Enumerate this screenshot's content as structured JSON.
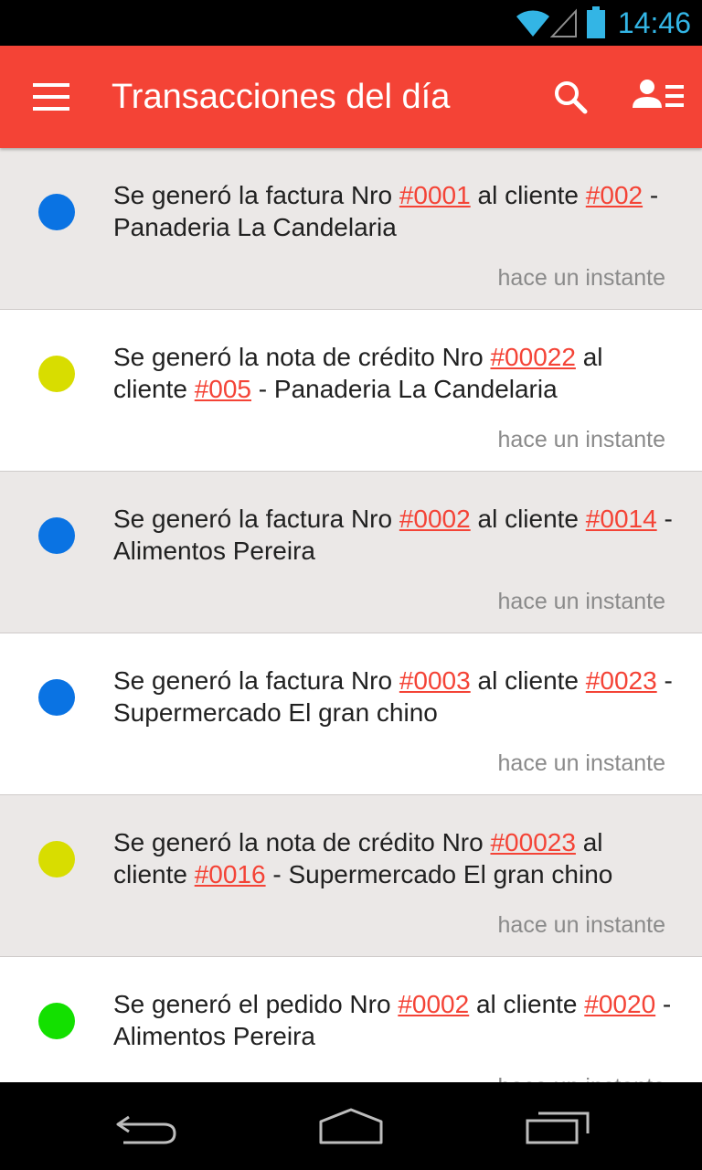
{
  "status_bar": {
    "time": "14:46",
    "accent_color": "#33b5e5",
    "icons": [
      "wifi-icon",
      "signal-icon",
      "battery-icon"
    ]
  },
  "app_bar": {
    "title": "Transacciones del día",
    "color": "#f44336",
    "icons": [
      "menu-icon",
      "search-icon",
      "contacts-icon"
    ]
  },
  "transactions": [
    {
      "color": "#0a73e3",
      "shaded": true,
      "prefix": "Se generó la factura Nro ",
      "doc": "#0001",
      "middle": " al cliente ",
      "client": "#002",
      "suffix": " - Panaderia La Candelaria",
      "time": "hace un instante"
    },
    {
      "color": "#d8dd00",
      "shaded": false,
      "prefix": "Se generó la nota de crédito Nro ",
      "doc": "#00022",
      "middle": " al cliente ",
      "client": "#005",
      "suffix": " - Panaderia La Candelaria",
      "time": "hace un instante"
    },
    {
      "color": "#0a73e3",
      "shaded": true,
      "prefix": "Se generó la factura Nro ",
      "doc": "#0002",
      "middle": " al cliente ",
      "client": "#0014",
      "suffix": " - Alimentos Pereira",
      "time": "hace un instante"
    },
    {
      "color": "#0a73e3",
      "shaded": false,
      "prefix": "Se generó la factura Nro ",
      "doc": "#0003",
      "middle": " al cliente ",
      "client": "#0023",
      "suffix": " - Supermercado El gran chino",
      "time": "hace un instante"
    },
    {
      "color": "#d8dd00",
      "shaded": true,
      "prefix": "Se generó la nota de crédito Nro ",
      "doc": "#00023",
      "middle": " al cliente ",
      "client": "#0016",
      "suffix": " - Supermercado El gran chino",
      "time": "hace un instante"
    },
    {
      "color": "#13e000",
      "shaded": false,
      "prefix": "Se generó el pedido Nro ",
      "doc": "#0002",
      "middle": " al cliente ",
      "client": "#0020",
      "suffix": " - Alimentos Pereira",
      "time": "hace un instante"
    }
  ],
  "nav_bar": {
    "icons": [
      "back-icon",
      "home-icon",
      "recent-apps-icon"
    ]
  }
}
